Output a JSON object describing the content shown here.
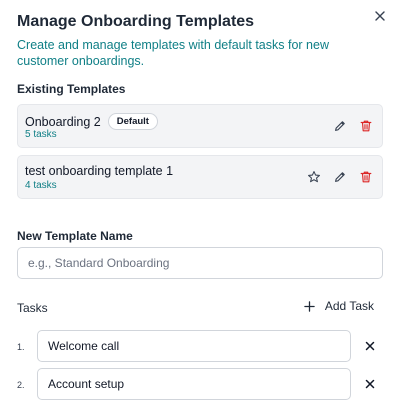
{
  "dialog": {
    "title": "Manage Onboarding Templates",
    "description": "Create and manage templates with default tasks for new customer onboardings.",
    "close_icon": "close-icon"
  },
  "existing": {
    "label": "Existing Templates",
    "templates": [
      {
        "name": "Onboarding 2",
        "badge": "Default",
        "count": "5 tasks",
        "is_default": true
      },
      {
        "name": "test onboarding template 1",
        "badge": "",
        "count": "4 tasks",
        "is_default": false
      }
    ]
  },
  "new_template": {
    "label": "New Template Name",
    "placeholder": "e.g., Standard Onboarding",
    "value": ""
  },
  "tasks": {
    "label": "Tasks",
    "add_label": "Add Task",
    "items": [
      {
        "num": "1.",
        "value": "Welcome call"
      },
      {
        "num": "2.",
        "value": "Account setup"
      }
    ]
  },
  "colors": {
    "accent_teal": "#0f7f86",
    "delete_red": "#dc2626",
    "card_bg": "#f3f4f6"
  }
}
